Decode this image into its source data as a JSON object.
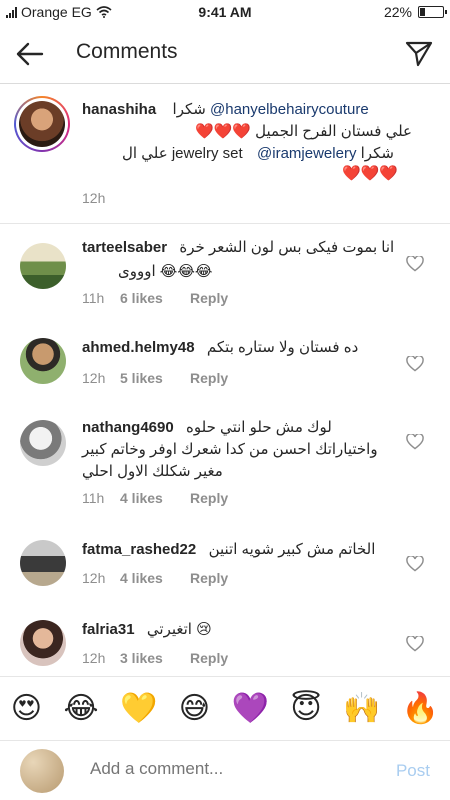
{
  "status_bar": {
    "carrier": "Orange EG",
    "time": "9:41 AM",
    "battery": "22%",
    "battery_level": 0.22
  },
  "header": {
    "title": "Comments"
  },
  "caption": {
    "username": "hanashiha",
    "line1_prefix": "شكرا",
    "line1_mention": "@hanyelbehairycouture",
    "line2": "علي فستان الفرح الجميل ❤️❤️❤️",
    "line3_prefix": "شكرا",
    "line3_mention": "@iramjewelery",
    "line3_suffix": "علي ال jewelry set",
    "line4": "❤️❤️❤️",
    "time": "12h"
  },
  "comments": [
    {
      "username": "tarteelsaber",
      "text1": "انا بموت فيكى بس لون الشعر خرة",
      "text2": "اوووى 😂😂😂",
      "time": "11h",
      "likes": "6 likes",
      "reply": "Reply"
    },
    {
      "username": "ahmed.helmy48",
      "text1": "ده فستان ولا ستاره بتكم",
      "text2": "",
      "time": "12h",
      "likes": "5 likes",
      "reply": "Reply"
    },
    {
      "username": "nathang4690",
      "text1": "لوك مش حلو انتي حلوه",
      "text2": "واختياراتك احسن من كدا شعرك اوفر وخاتم كبير",
      "text3": "مغير شكلك الاول احلي",
      "time": "11h",
      "likes": "4 likes",
      "reply": "Reply"
    },
    {
      "username": "fatma_rashed22",
      "text1": "الخاتم مش كبير شويه اتنين",
      "text2": "",
      "time": "12h",
      "likes": "4 likes",
      "reply": "Reply"
    },
    {
      "username": "falria31",
      "text1": "اتغيرتي 😢",
      "text2": "",
      "time": "12h",
      "likes": "3 likes",
      "reply": "Reply"
    }
  ],
  "emoji_bar": [
    "😍",
    "😂",
    "💛",
    "😅",
    "💜",
    "😇",
    "🙌",
    "🔥"
  ],
  "input": {
    "placeholder": "Add a comment...",
    "post_label": "Post"
  },
  "colors": {
    "mention": "#1a3a6e",
    "muted": "#8e8e8e",
    "post_disabled": "#a9cdf0"
  }
}
